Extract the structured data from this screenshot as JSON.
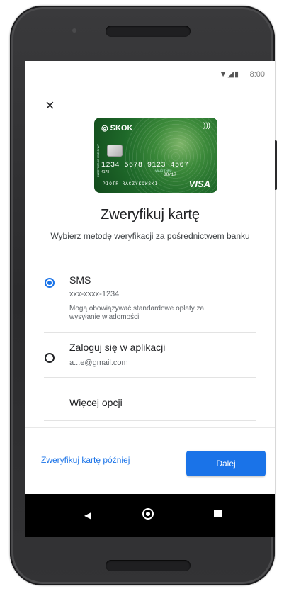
{
  "status_bar": {
    "time": "8:00",
    "icons": "▼◢▮"
  },
  "dialog": {
    "close_icon": "×",
    "title": "Zweryfikuj kartę",
    "subtitle": "Wybierz metodę weryfikacji za pośrednictwem banku"
  },
  "card": {
    "brand": "SKOK",
    "contactless": ")))",
    "number": "1234 5678 9123 4567",
    "small_number": "4178",
    "vertical_text": "ELECTRONIC USE ONLY",
    "valid_text": "VALID THRU",
    "expiry": "08/17",
    "holder": "PIOTR RACZYKOWSKI",
    "network": "VISA"
  },
  "options": [
    {
      "title": "SMS",
      "value": "xxx-xxxx-1234",
      "note": "Mogą obowiązywać standardowe opłaty za wysyłanie wiadomości",
      "selected": true
    },
    {
      "title": "Zaloguj się w aplikacji",
      "value": "a...e@gmail.com",
      "selected": false
    }
  ],
  "more_options_label": "Więcej opcji",
  "footer": {
    "later_label": "Zweryfikuj kartę później",
    "next_label": "Dalej"
  },
  "colors": {
    "accent": "#1a73e8",
    "card_green": "#1f6a2a"
  }
}
